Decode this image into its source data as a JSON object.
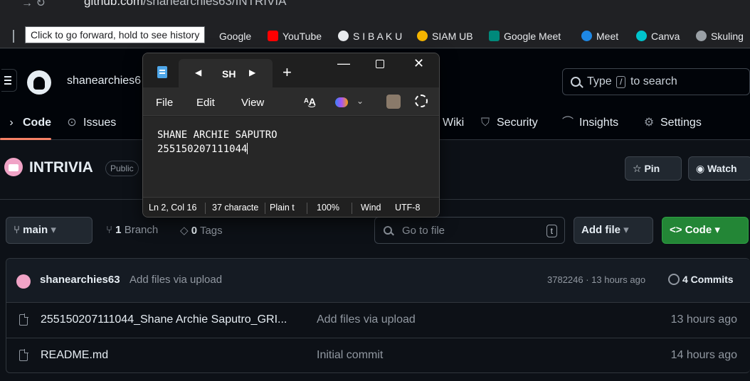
{
  "browser": {
    "url_host": "github.com",
    "url_path": "/shanearchies63/INTRIVIA",
    "tooltip": "Click to go forward, hold to see history",
    "bookmarks": [
      {
        "label": "Google",
        "color": "#4285f4"
      },
      {
        "label": "YouTube",
        "color": "#ff0000"
      },
      {
        "label": "S I B A K U",
        "color": "#9aa0a6"
      },
      {
        "label": "SIAM UB",
        "color": "#f4b400"
      },
      {
        "label": "Google Meet",
        "color": "#00897b"
      },
      {
        "label": "Meet",
        "color": "#1e88e5"
      },
      {
        "label": "Canva",
        "color": "#00c4cc"
      },
      {
        "label": "Skuling",
        "color": "#9aa0a6"
      }
    ]
  },
  "github": {
    "owner": "shanearchies6",
    "search": {
      "prefix": "Type",
      "key": "/",
      "suffix": "to search"
    },
    "tabs": [
      {
        "label": "Code",
        "icon": "code-icon"
      },
      {
        "label": "Issues",
        "icon": "issue-icon"
      },
      {
        "label": "Wiki",
        "icon": "book-icon"
      },
      {
        "label": "Security",
        "icon": "shield-icon"
      },
      {
        "label": "Insights",
        "icon": "graph-icon"
      },
      {
        "label": "Settings",
        "icon": "gear-icon"
      }
    ],
    "repo": {
      "name": "INTRIVIA",
      "visibility": "Public",
      "pin_label": "Pin",
      "watch_label": "Watch"
    },
    "toolbar": {
      "branch": "main",
      "branch_count": "1",
      "branch_word": "Branch",
      "tag_count": "0",
      "tag_word": "Tags",
      "goto_placeholder": "Go to file",
      "goto_key": "t",
      "add_file": "Add file",
      "code": "Code"
    },
    "latest_commit": {
      "author": "shanearchies63",
      "message": "Add files via upload",
      "meta": "3782246 · 13 hours ago",
      "commits": "4 Commits"
    },
    "files": [
      {
        "name": "255150207111044_Shane Archie Saputro_GRI...",
        "message": "Add files via upload",
        "time": "13 hours ago"
      },
      {
        "name": "README.md",
        "message": "Initial commit",
        "time": "14 hours ago"
      }
    ]
  },
  "notepad": {
    "tab_title": "SH",
    "menu": [
      "File",
      "Edit",
      "View"
    ],
    "content_line1": "SHANE ARCHIE SAPUTRO",
    "content_line2": "255150207111044",
    "status": {
      "position": "Ln 2, Col 16",
      "chars": "37 characte",
      "format": "Plain t",
      "zoom": "100%",
      "line_ending": "Wind",
      "encoding": "UTF-8"
    }
  }
}
